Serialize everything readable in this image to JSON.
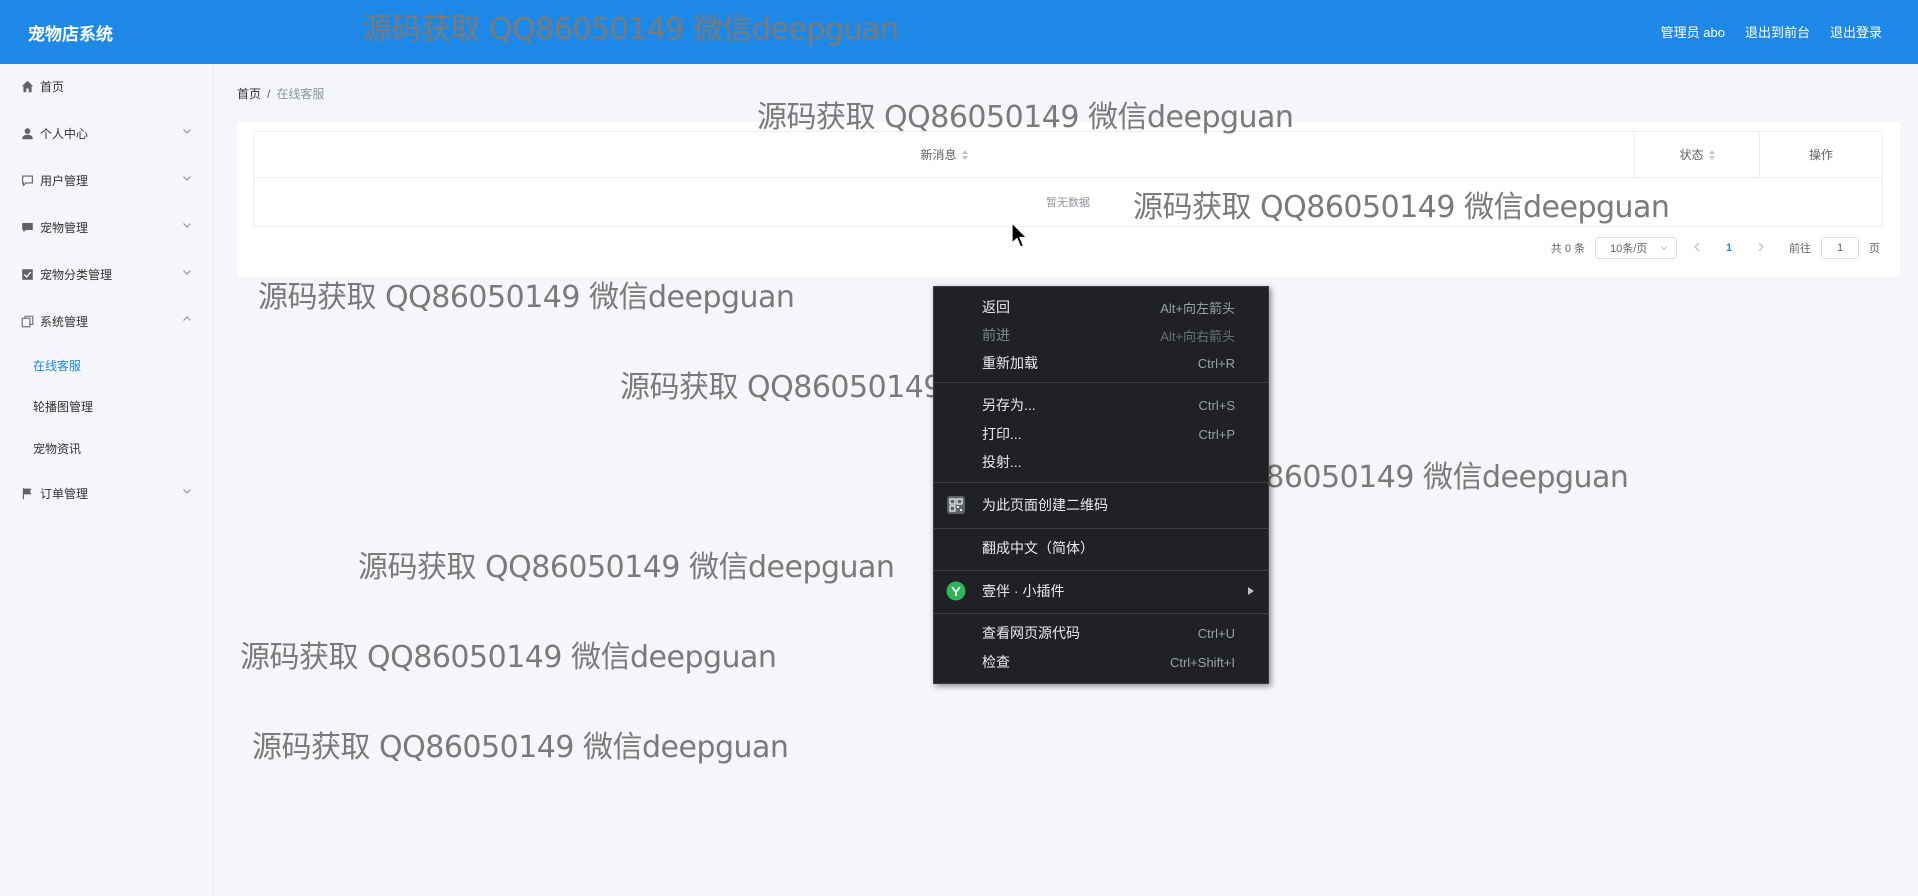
{
  "app": {
    "title": "宠物店系统",
    "header_links": [
      "管理员 abo",
      "退出到前台",
      "退出登录"
    ]
  },
  "sidebar": {
    "items": [
      {
        "label": "首页",
        "icon": "home-icon"
      },
      {
        "label": "个人中心",
        "icon": "user-icon"
      },
      {
        "label": "用户管理",
        "icon": "chat-icon"
      },
      {
        "label": "宠物管理",
        "icon": "message-icon"
      },
      {
        "label": "宠物分类管理",
        "icon": "check-square-icon"
      },
      {
        "label": "系统管理",
        "icon": "copy-icon"
      },
      {
        "label": "订单管理",
        "icon": "flag-icon"
      }
    ],
    "sub_items": [
      "在线客服",
      "轮播图管理",
      "宠物资讯"
    ]
  },
  "breadcrumb": {
    "home": "首页",
    "separator": "/",
    "current": "在线客服"
  },
  "table": {
    "columns": [
      "新消息",
      "状态",
      "操作"
    ],
    "empty_text": "暂无数据"
  },
  "pagination": {
    "total": "共 0 条",
    "page_size": "10条/页",
    "current_page": "1",
    "goto_label": "前往",
    "goto_value": "1",
    "page_unit": "页"
  },
  "watermark": "源码获取 QQ86050149 微信deepguan",
  "context_menu": {
    "items": [
      {
        "label": "返回",
        "shortcut": "Alt+向左箭头"
      },
      {
        "label": "前进",
        "shortcut": "Alt+向右箭头"
      },
      {
        "label": "重新加载",
        "shortcut": "Ctrl+R"
      },
      {
        "label": "另存为...",
        "shortcut": "Ctrl+S"
      },
      {
        "label": "打印...",
        "shortcut": "Ctrl+P"
      },
      {
        "label": "投射...",
        "shortcut": ""
      },
      {
        "label": "为此页面创建二维码",
        "shortcut": ""
      },
      {
        "label": "翻成中文（简体）",
        "shortcut": ""
      },
      {
        "label": "壹伴 · 小插件",
        "shortcut": ""
      },
      {
        "label": "查看网页源代码",
        "shortcut": "Ctrl+U"
      },
      {
        "label": "检查",
        "shortcut": "Ctrl+Shift+I"
      }
    ]
  },
  "colors": {
    "header_bg": "#1d88e5",
    "accent": "#1d88e5",
    "menu_bg": "#202124",
    "plugin_green": "#2fb45a"
  }
}
